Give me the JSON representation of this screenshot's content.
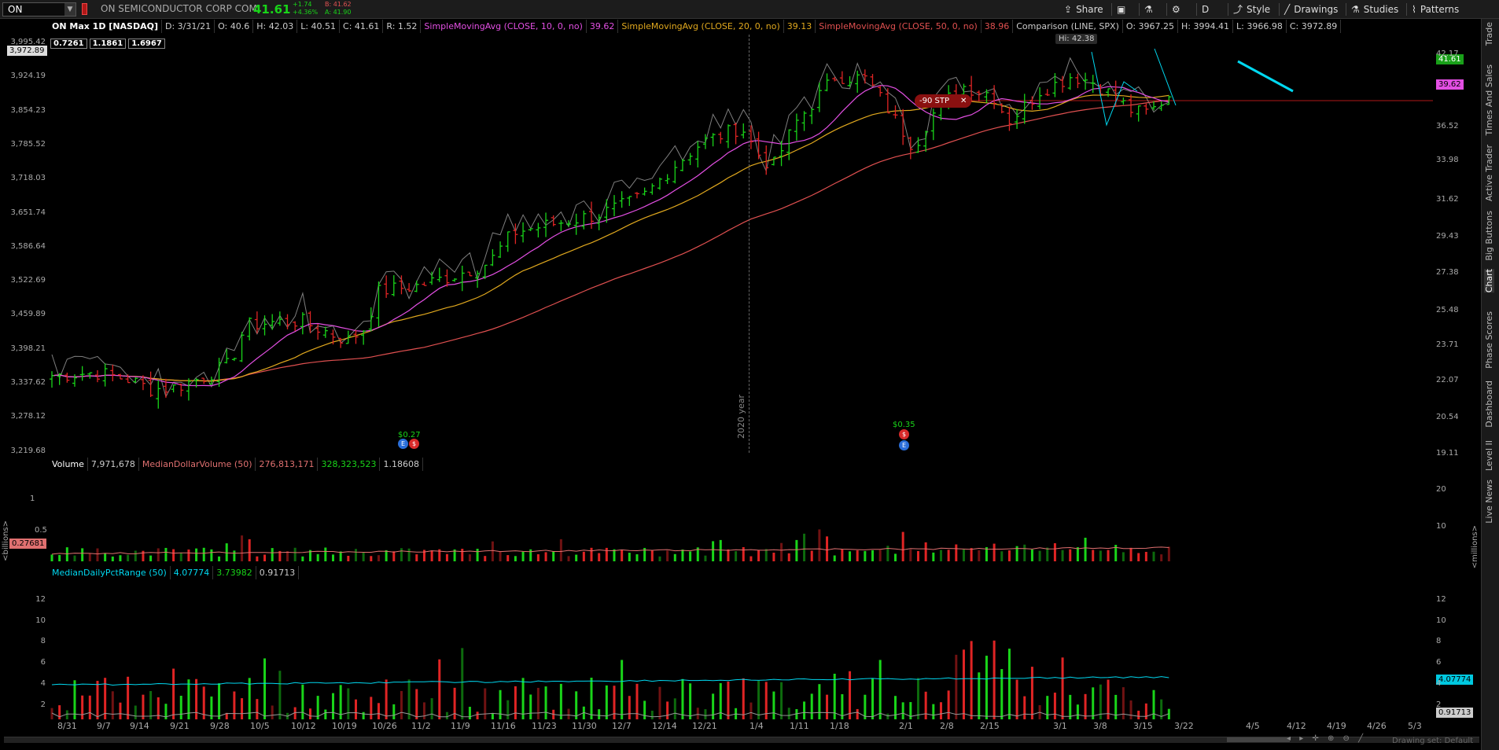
{
  "symbol": "ON",
  "company": "ON SEMICONDUCTOR CORP COM",
  "last": "41.61",
  "change": "+1.74",
  "change_pct": "+4.36%",
  "bid": "B: 41.62",
  "ask": "A: 41.90",
  "toolbar": {
    "share": "Share",
    "aggregation": "D",
    "style": "Style",
    "drawings": "Drawings",
    "studies": "Studies",
    "patterns": "Patterns"
  },
  "side_tabs": [
    "Trade",
    "Times And Sales",
    "Active Trader",
    "Big Buttons",
    "Chart",
    "Phase Scores",
    "Dashboard",
    "Level II",
    "Live News"
  ],
  "header": {
    "title": "ON Max 1D [NASDAQ]",
    "date": "D: 3/31/21",
    "open": "O: 40.6",
    "high": "H: 42.03",
    "low": "L: 40.51",
    "close": "C: 41.61",
    "range": "R: 1.52",
    "sma10_label": "SimpleMovingAvg (CLOSE, 10, 0, no)",
    "sma10_val": "39.62",
    "sma20_label": "SimpleMovingAvg (CLOSE, 20, 0, no)",
    "sma20_val": "39.13",
    "sma50_label": "SimpleMovingAvg (CLOSE, 50, 0, no)",
    "sma50_val": "38.96",
    "comparison_label": "Comparison (LINE, SPX)",
    "cmp_open": "O: 3967.25",
    "cmp_high": "H: 3994.41",
    "cmp_low": "L: 3966.98",
    "cmp_close": "C: 3972.89"
  },
  "ratio_boxes": [
    "0.7261",
    "1.1861",
    "1.6967"
  ],
  "spx_axis": [
    "3,995.42",
    "3,924.19",
    "3,854.23",
    "3,785.52",
    "3,718.03",
    "3,651.74",
    "3,586.64",
    "3,522.69",
    "3,459.89",
    "3,398.21",
    "3,337.62",
    "3,278.12",
    "3,219.68"
  ],
  "spx_badge": "3,972.89",
  "price_axis": [
    "42.17",
    "36.52",
    "33.98",
    "31.62",
    "29.43",
    "27.38",
    "25.48",
    "23.71",
    "22.07",
    "20.54",
    "19.11"
  ],
  "price_badge_last": "41.61",
  "price_badge_sma": "39.62",
  "hi_label": "Hi: 42.38",
  "stp_order": "-90 STP",
  "stp_close": "✕",
  "year_label": "2020 year",
  "dividends": [
    "$0.27",
    "$0.35"
  ],
  "volume_header": {
    "label": "Volume",
    "value": "7,971,678",
    "mdv_label": "MedianDollarVolume (50)",
    "mdv1": "276,813,171",
    "mdv2": "328,323,523",
    "mdv3": "1.18608"
  },
  "volume_left_axis": [
    "1",
    "0.5"
  ],
  "volume_left_unit": "<billions>",
  "volume_left_badge": "0.27681",
  "volume_right_axis": [
    "20",
    "10"
  ],
  "volume_right_unit": "<millions>",
  "range_header": {
    "label": "MedianDailyPctRange (50)",
    "v1": "4.07774",
    "v2": "3.73982",
    "v3": "0.91713"
  },
  "range_axis": [
    "12",
    "10",
    "8",
    "6",
    "4",
    "2"
  ],
  "range_badge1": "4.07774",
  "range_badge2": "0.91713",
  "x_axis": [
    "8/31",
    "9/7",
    "9/14",
    "9/21",
    "9/28",
    "10/5",
    "10/12",
    "10/19",
    "10/26",
    "11/2",
    "11/9",
    "11/16",
    "11/23",
    "11/30",
    "12/7",
    "12/14",
    "12/21",
    "1/4",
    "1/11",
    "1/18",
    "2/1",
    "2/8",
    "2/15",
    "3/1",
    "3/8",
    "3/15",
    "3/22",
    "4/5",
    "4/12",
    "4/19",
    "4/26",
    "5/3"
  ],
  "drawing_set": "Drawing set: Default",
  "colors": {
    "up": "#19d419",
    "down": "#e02424",
    "sma10": "#e34fe3",
    "sma20": "#e0a81e",
    "sma50": "#e05050",
    "spx": "#aaaaaa",
    "trend": "#00d8f0"
  }
}
